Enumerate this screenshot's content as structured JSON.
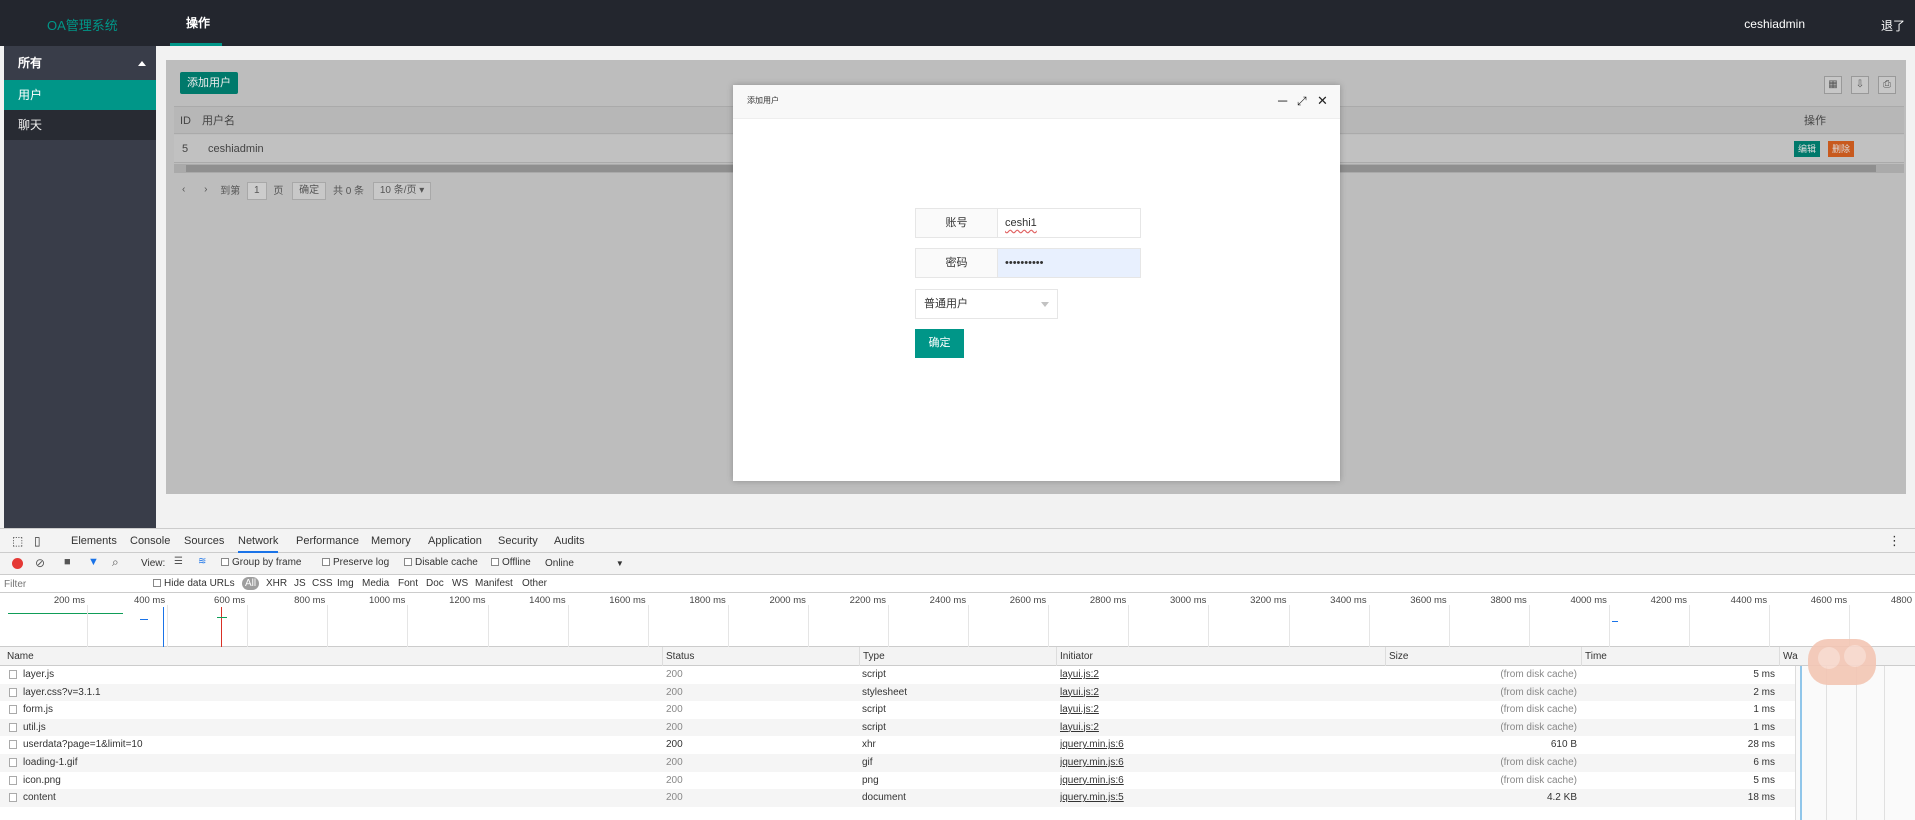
{
  "topbar": {
    "logo": "OA管理系统",
    "nav": "操作",
    "user": "ceshiadmin",
    "logout": "退了"
  },
  "sidebar": {
    "header": "所有",
    "items": [
      {
        "label": "用户",
        "active": true
      },
      {
        "label": "聊天",
        "active": false
      }
    ]
  },
  "content": {
    "add_button": "添加用户",
    "table": {
      "headers": [
        "ID",
        "用户名",
        "操作"
      ],
      "rows": [
        {
          "id": "5",
          "username": "ceshiadmin",
          "edit": "编辑",
          "delete": "删除"
        }
      ]
    },
    "pager": {
      "goto": "到第",
      "page_value": "1",
      "page_unit": "页",
      "confirm": "确定",
      "total": "共 0 条",
      "per_page": "10 条/页"
    }
  },
  "modal": {
    "title": "添加用户",
    "account_label": "账号",
    "account_value": "ceshi1",
    "password_label": "密码",
    "password_value": "••••••••••",
    "role_value": "普通用户",
    "submit": "确定"
  },
  "devtools": {
    "tabs": [
      "Elements",
      "Console",
      "Sources",
      "Network",
      "Performance",
      "Memory",
      "Application",
      "Security",
      "Audits"
    ],
    "selected_tab": "Network",
    "toolbar": {
      "view": "View:",
      "group": "Group by frame",
      "preserve": "Preserve log",
      "disable_cache": "Disable cache",
      "offline": "Offline",
      "throttle": "Online"
    },
    "filter": {
      "placeholder": "Filter",
      "hide_data": "Hide data URLs",
      "types": [
        "All",
        "XHR",
        "JS",
        "CSS",
        "Img",
        "Media",
        "Font",
        "Doc",
        "WS",
        "Manifest",
        "Other"
      ]
    },
    "timeline_ticks": [
      "200 ms",
      "400 ms",
      "600 ms",
      "800 ms",
      "1000 ms",
      "1200 ms",
      "1400 ms",
      "1600 ms",
      "1800 ms",
      "2000 ms",
      "2200 ms",
      "2400 ms",
      "2600 ms",
      "2800 ms",
      "3000 ms",
      "3200 ms",
      "3400 ms",
      "3600 ms",
      "3800 ms",
      "4000 ms",
      "4200 ms",
      "4400 ms",
      "4600 ms",
      "4800 ms"
    ],
    "columns": [
      "Name",
      "Status",
      "Type",
      "Initiator",
      "Size",
      "Time",
      "Wa"
    ],
    "rows": [
      {
        "name": "layer.js",
        "status": "200",
        "type": "script",
        "initiator": "layui.js:2",
        "size": "(from disk cache)",
        "time": "5 ms"
      },
      {
        "name": "layer.css?v=3.1.1",
        "status": "200",
        "type": "stylesheet",
        "initiator": "layui.js:2",
        "size": "(from disk cache)",
        "time": "2 ms"
      },
      {
        "name": "form.js",
        "status": "200",
        "type": "script",
        "initiator": "layui.js:2",
        "size": "(from disk cache)",
        "time": "1 ms"
      },
      {
        "name": "util.js",
        "status": "200",
        "type": "script",
        "initiator": "layui.js:2",
        "size": "(from disk cache)",
        "time": "1 ms"
      },
      {
        "name": "userdata?page=1&limit=10",
        "status": "200",
        "type": "xhr",
        "initiator": "jquery.min.js:6",
        "size": "610 B",
        "time": "28 ms"
      },
      {
        "name": "loading-1.gif",
        "status": "200",
        "type": "gif",
        "initiator": "jquery.min.js:6",
        "size": "(from disk cache)",
        "time": "6 ms"
      },
      {
        "name": "icon.png",
        "status": "200",
        "type": "png",
        "initiator": "jquery.min.js:6",
        "size": "(from disk cache)",
        "time": "5 ms"
      },
      {
        "name": "content",
        "status": "200",
        "type": "document",
        "initiator": "jquery.min.js:5",
        "size": "4.2 KB",
        "time": "18 ms"
      }
    ]
  }
}
